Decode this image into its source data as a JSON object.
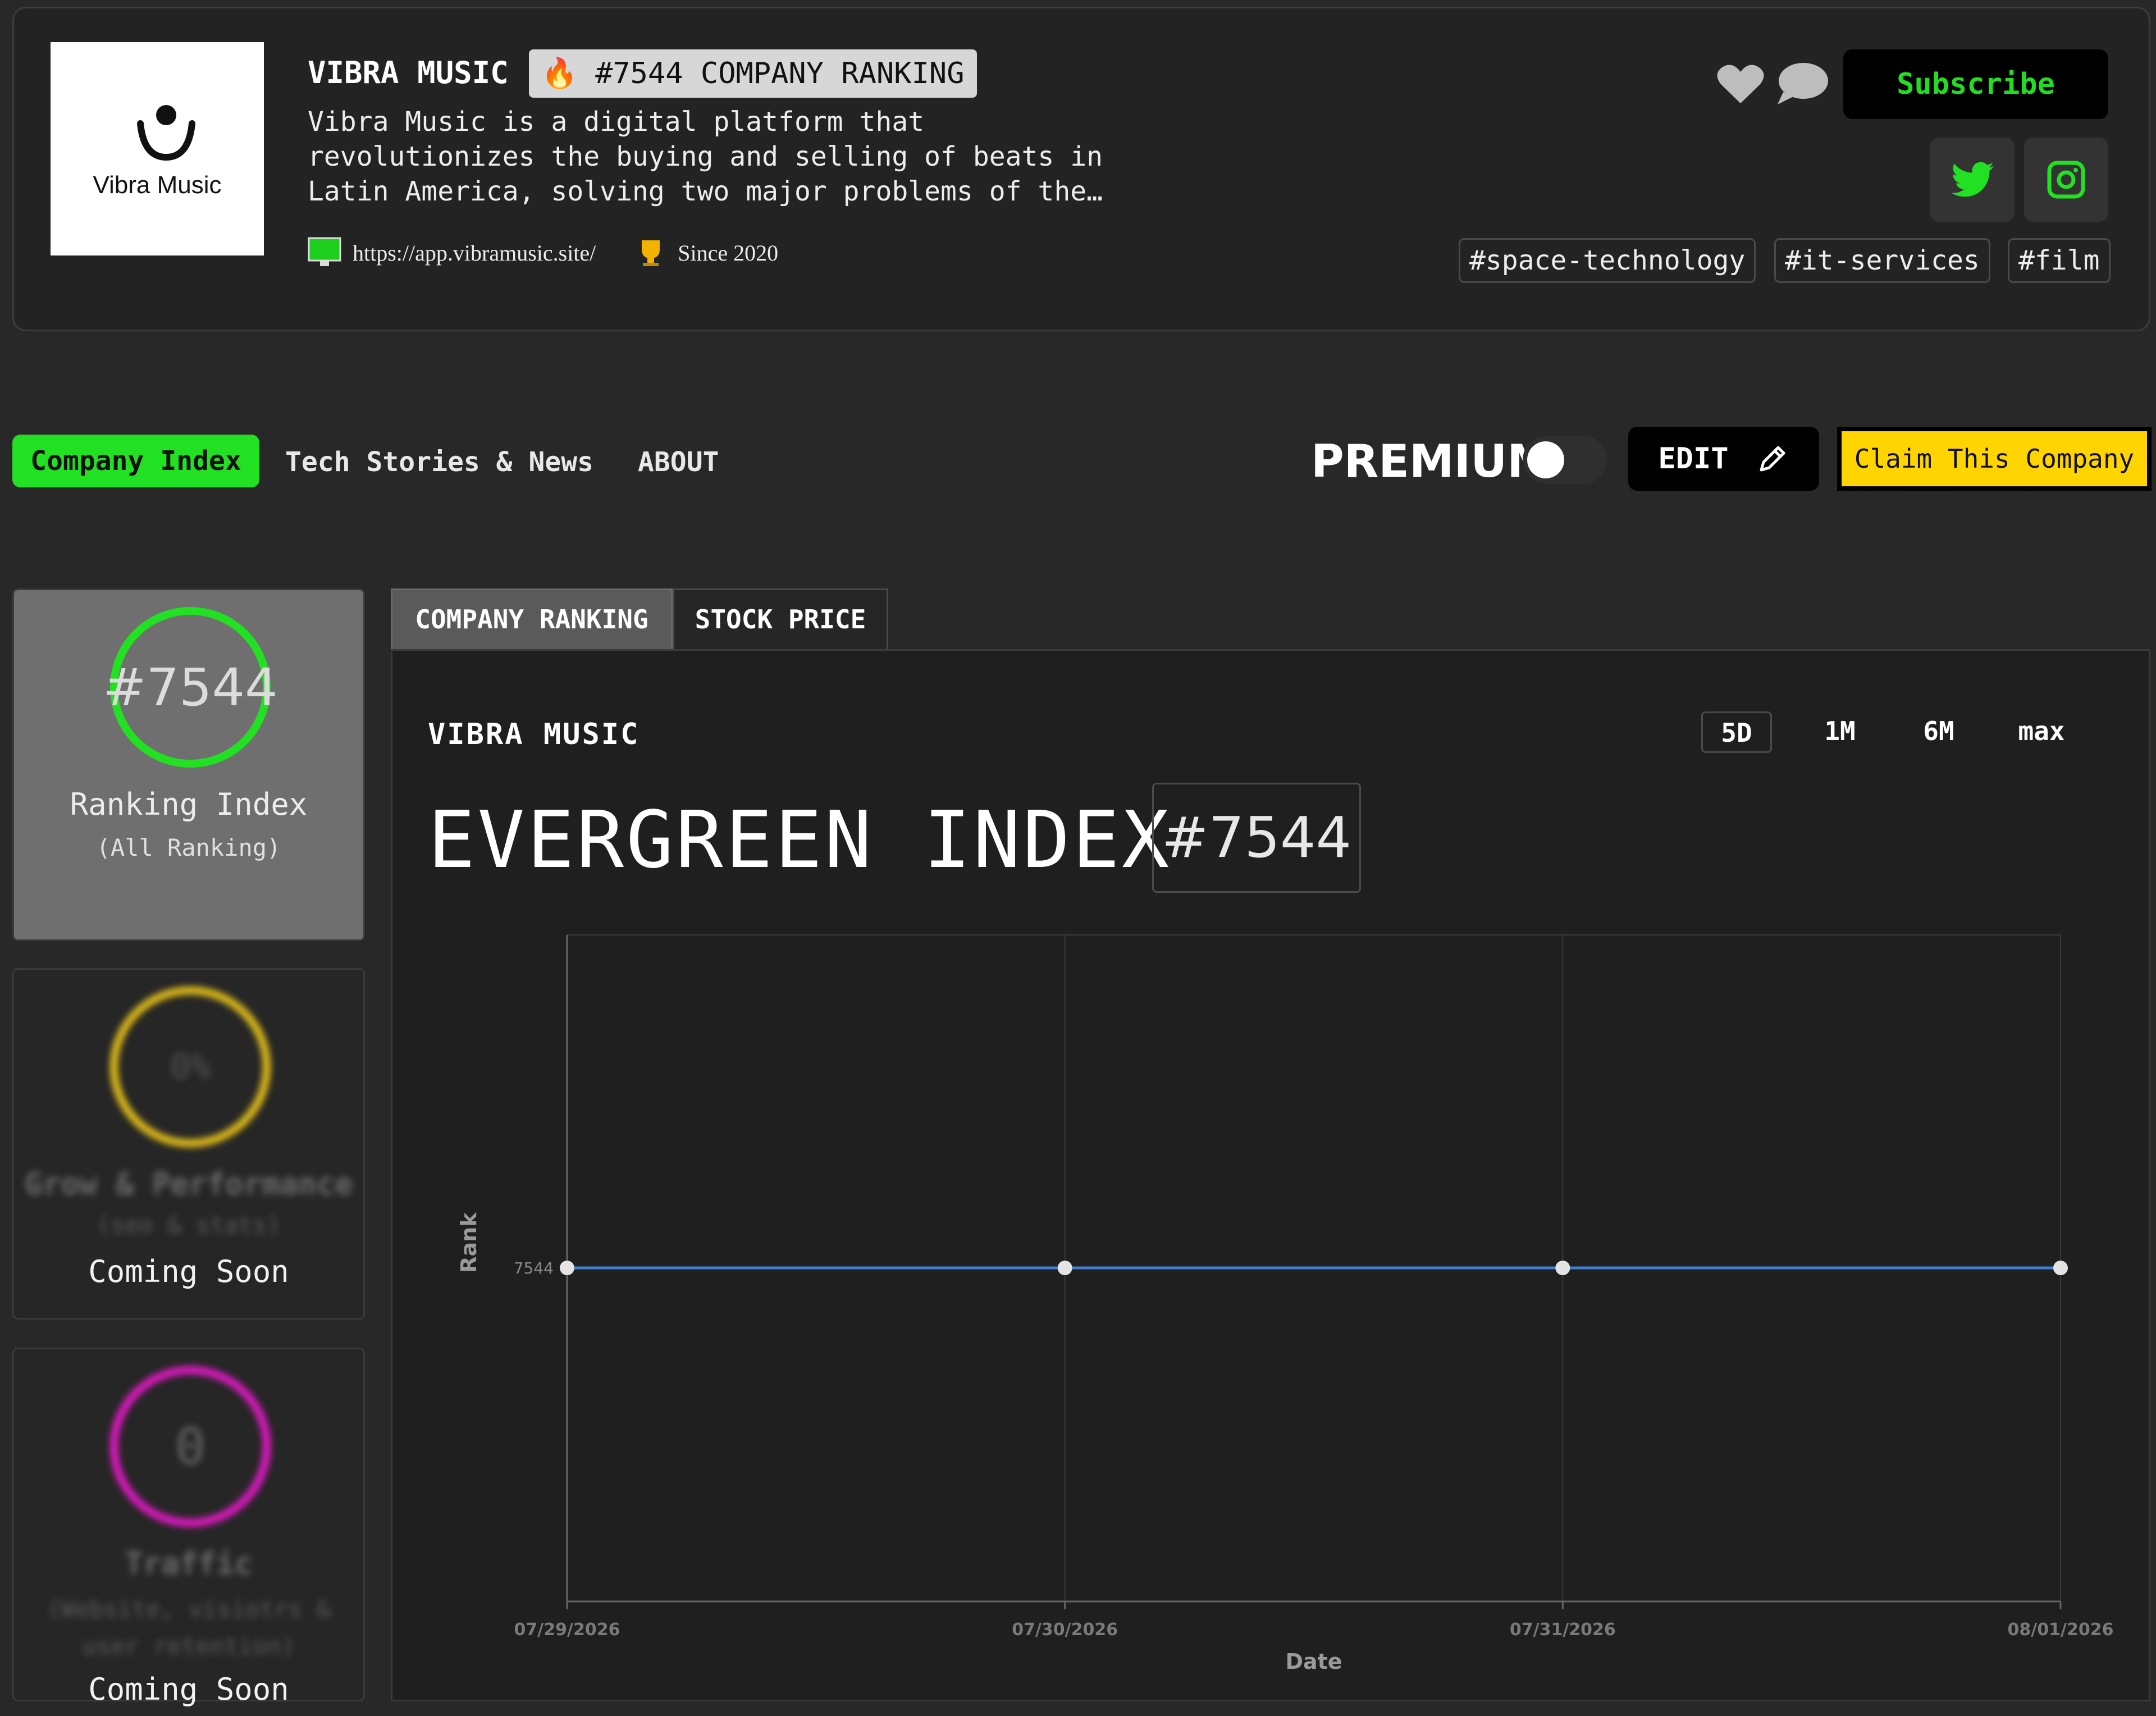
{
  "header": {
    "logo_text": "Vibra Music",
    "company_name": "VIBRA MUSIC",
    "rank_badge": "#7544 COMPANY RANKING",
    "description": "Vibra Music is a digital platform that revolutionizes the buying and selling of beats in Latin America, solving two major problems of the…",
    "website": "https://app.vibramusic.site/",
    "since": "Since 2020",
    "subscribe_label": "Subscribe",
    "tags": [
      "#space-technology",
      "#it-services",
      "#film"
    ]
  },
  "nav": {
    "company_index": "Company Index",
    "tech_stories": "Tech Stories & News",
    "about": "ABOUT",
    "premium": "PREMIUM",
    "edit": "EDIT",
    "claim": "Claim This Company"
  },
  "metrics": {
    "ranking": {
      "value": "#7544",
      "title": "Ranking Index",
      "subtitle": "(All Ranking)"
    },
    "grow": {
      "value": "0%",
      "title": "Grow & Performance",
      "subtitle": "(seo & stats)",
      "status": "Coming Soon"
    },
    "traffic": {
      "value": "0",
      "title": "Traffic",
      "subtitle": "(Website, visiotrs & user retention)",
      "status": "Coming Soon"
    }
  },
  "tabs": {
    "ranking": "COMPANY RANKING",
    "stock": "STOCK PRICE"
  },
  "chart_header": {
    "company": "VIBRA MUSIC",
    "ranges": [
      "5D",
      "1M",
      "6M",
      "max"
    ],
    "index_title": "EVERGREEN INDEX",
    "index_rank": "#7544"
  },
  "colors": {
    "accent_green": "#22e022",
    "ring_yellow": "#e6c21a",
    "ring_magenta": "#e619c8",
    "line_blue": "#3f7fd0",
    "claim_yellow": "#ffd400"
  },
  "chart_data": {
    "type": "line",
    "xlabel": "Date",
    "ylabel": "Rank",
    "x": [
      "07/29/2026",
      "07/30/2026",
      "07/31/2026",
      "08/01/2026"
    ],
    "series": [
      {
        "values": [
          7544,
          7544,
          7544,
          7544
        ]
      }
    ],
    "y_ticks": [
      "7544"
    ],
    "grid": true
  }
}
